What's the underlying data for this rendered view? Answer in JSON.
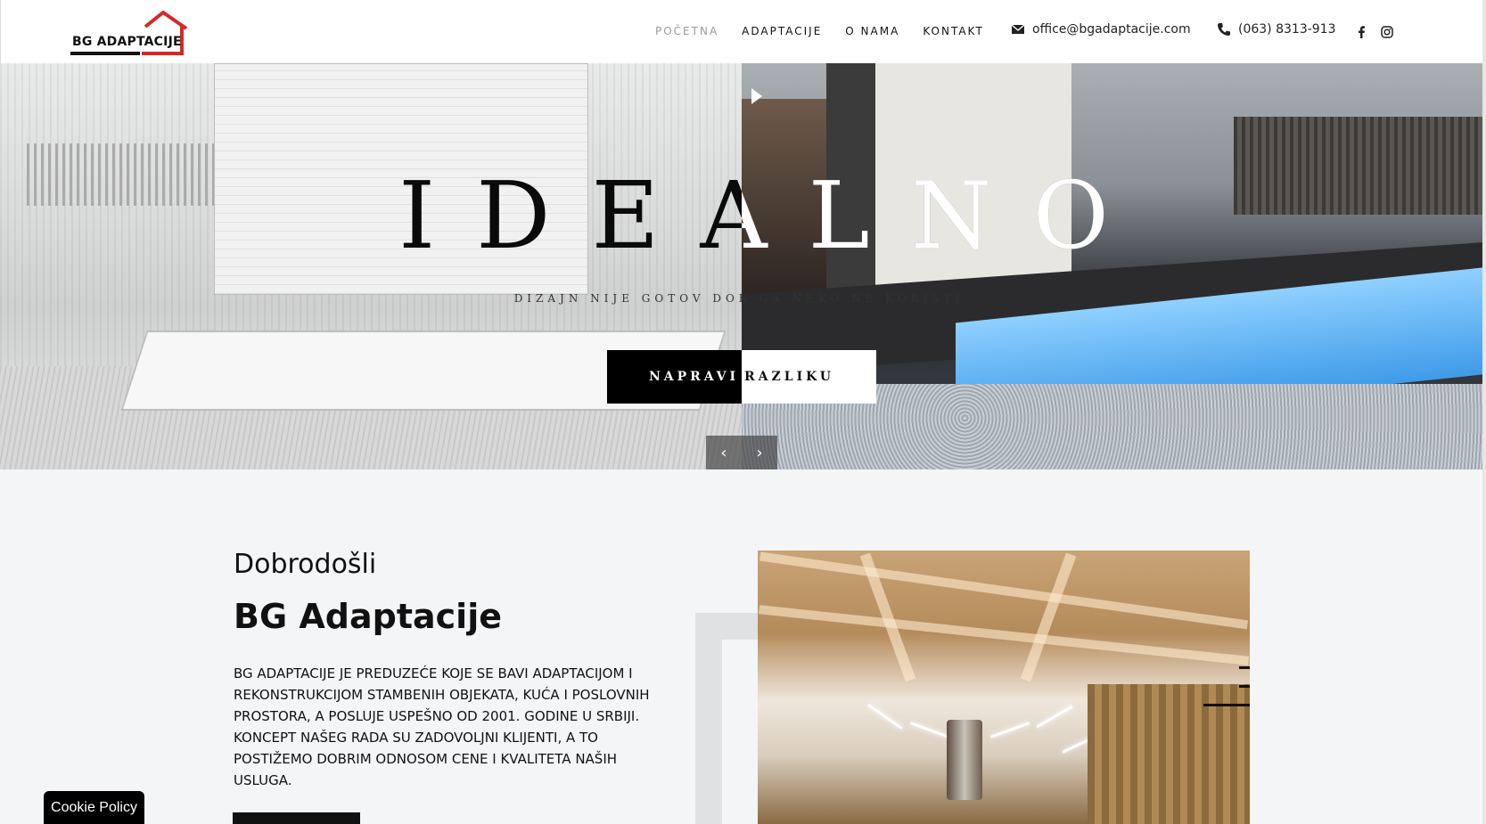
{
  "logo": {
    "text": "BG ADAPTACIJE"
  },
  "nav": {
    "items": [
      {
        "label": "POČETNA"
      },
      {
        "label": "ADAPTACIJE"
      },
      {
        "label": "O NAMA"
      },
      {
        "label": "KONTAKT"
      }
    ]
  },
  "contact": {
    "email": "office@bgadaptacije.com",
    "phone": "(063) 8313-913"
  },
  "hero": {
    "title": "IDEALNO",
    "subtitle": "DIZAJN NIJE GOTOV DOK GA NEKO NE KORISTI.",
    "button_part1": "NAPRAVI",
    "button_part2": "RAZLIKU",
    "prev": "‹",
    "next": "›"
  },
  "welcome": {
    "small_title": "Dobrodošli",
    "big_title": "BG Adaptacije",
    "text": "BG ADAPTACIJE JE PREDUZEĆE KOJE SE BAVI ADAPTACIJOM I REKONSTRUKCIJOM STAMBENIH OBJEKATA, KUĆA I POSLOVNIH PROSTORA, A POSLUJE USPEŠNO OD 2001. GODINE U SRBIJI. KONCEPT NAŠEG RADA SU ZADOVOLJNI KLIJENTI, A TO POSTIŽEMO DOBRIM ODNOSOM CENE I KVALITETA NAŠIH USLUGA."
  },
  "cookie": {
    "label": "Cookie Policy"
  },
  "colors": {
    "logo_red": "#d82727",
    "text": "#111111",
    "nav_active": "#9a9a9a"
  }
}
